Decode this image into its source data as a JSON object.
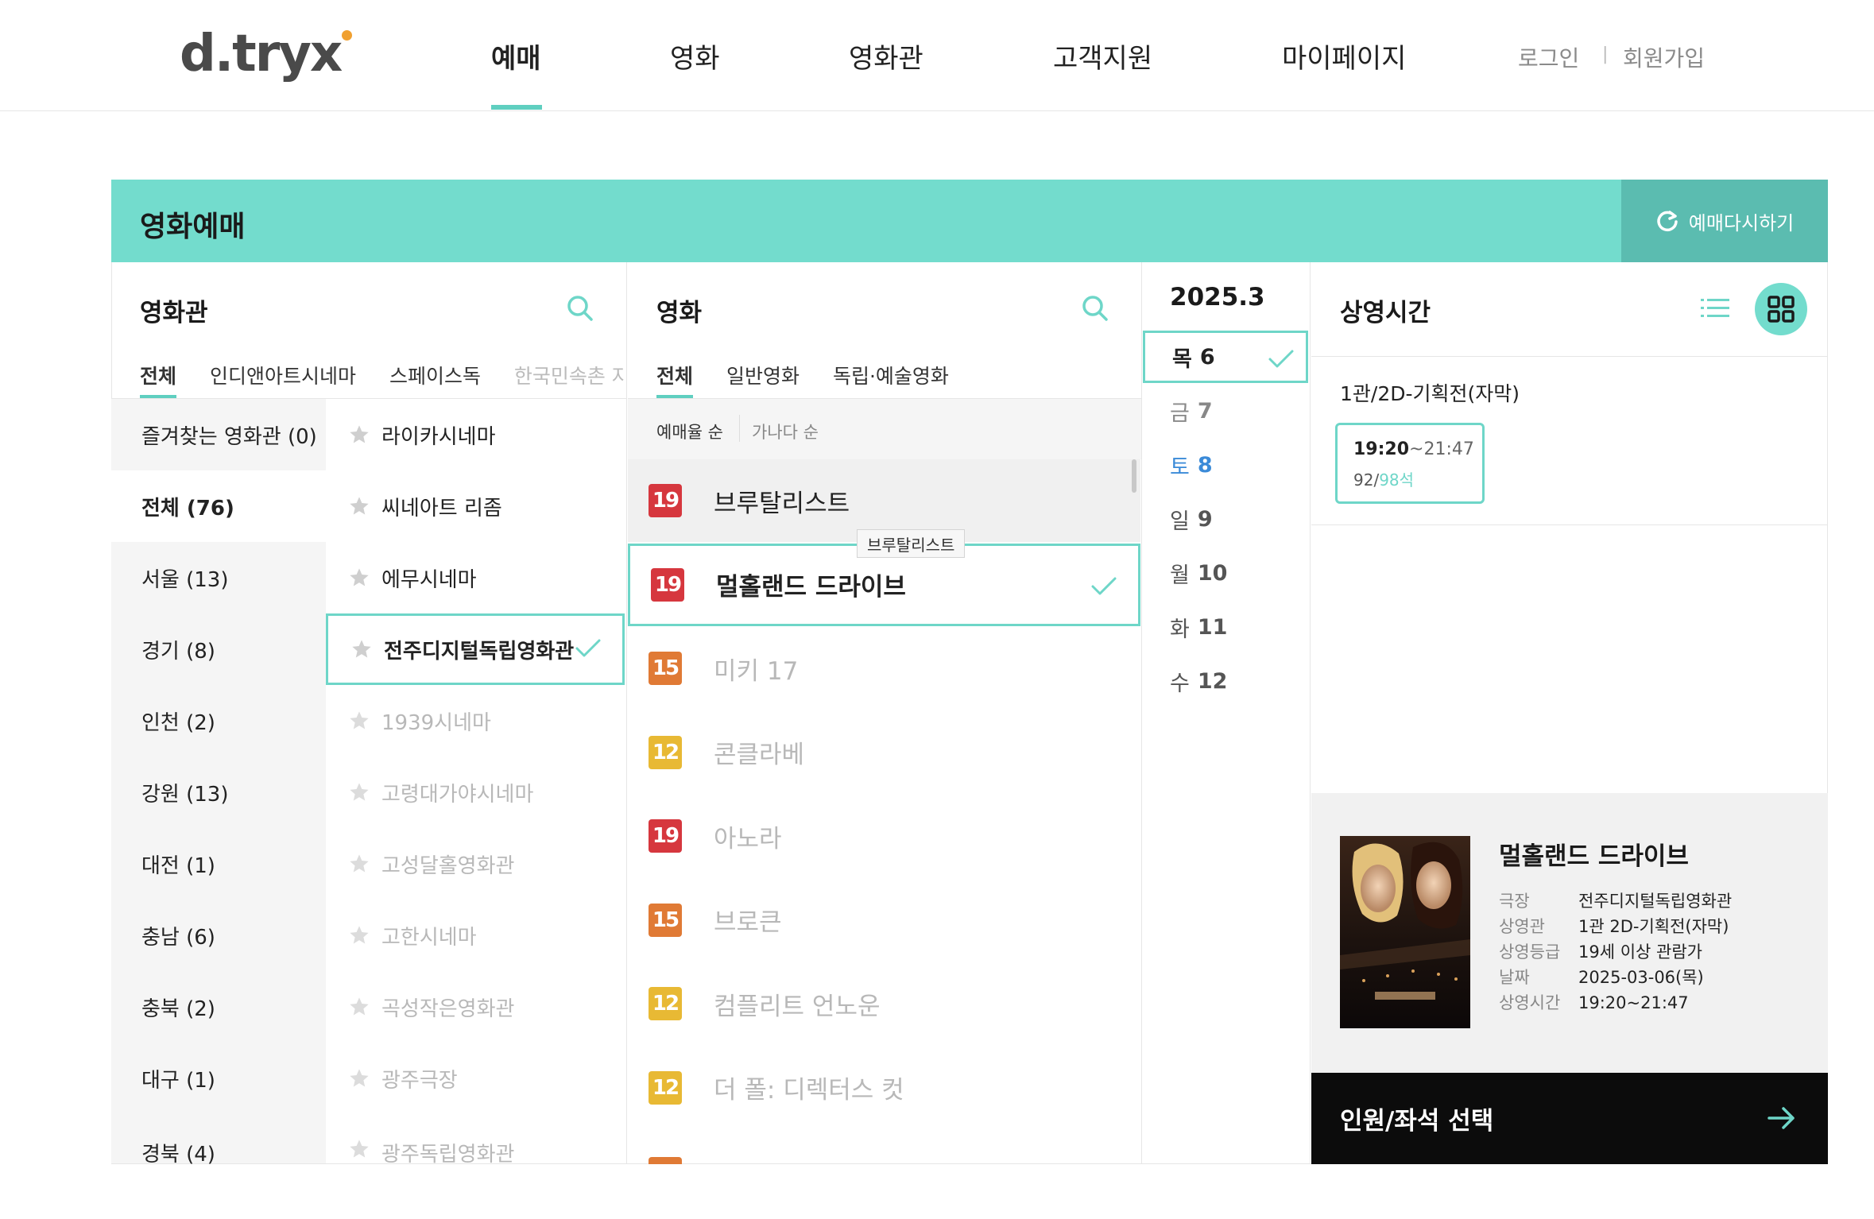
{
  "header": {
    "logo": "d.tryx",
    "nav": [
      "예매",
      "영화",
      "영화관",
      "고객지원",
      "마이페이지"
    ],
    "login": "로그인",
    "signup": "회원가입"
  },
  "banner": {
    "title": "영화예매",
    "rebook": "예매다시하기"
  },
  "cinema_panel": {
    "title": "영화관",
    "tabs": [
      "전체",
      "인디앤아트시네마",
      "스페이스독",
      "한국민속촌 자동"
    ],
    "regions": [
      "즐겨찾는 영화관 (0)",
      "전체 (76)",
      "서울 (13)",
      "경기 (8)",
      "인천 (2)",
      "강원 (13)",
      "대전 (1)",
      "충남 (6)",
      "충북 (2)",
      "대구 (1)",
      "경북 (4)"
    ],
    "cinemas": [
      "라이카시네마",
      "씨네아트 리좀",
      "에무시네마",
      "전주디지털독립영화관",
      "1939시네마",
      "고령대가야시네마",
      "고성달홀영화관",
      "고한시네마",
      "곡성작은영화관",
      "광주극장",
      "광주독립영화관"
    ]
  },
  "movie_panel": {
    "title": "영화",
    "tabs": [
      "전체",
      "일반영화",
      "독립·예술영화"
    ],
    "sort": [
      "예매율 순",
      "가나다 순"
    ],
    "movies": [
      {
        "rating": "19",
        "title": "브루탈리스트"
      },
      {
        "rating": "19",
        "title": "멀홀랜드 드라이브"
      },
      {
        "rating": "15",
        "title": "미키 17"
      },
      {
        "rating": "12",
        "title": "콘클라베"
      },
      {
        "rating": "19",
        "title": "아노라"
      },
      {
        "rating": "15",
        "title": "브로큰"
      },
      {
        "rating": "12",
        "title": "컴플리트 언노운"
      },
      {
        "rating": "12",
        "title": "더 폴: 디렉터스 컷"
      }
    ],
    "tooltip": "브루탈리스트"
  },
  "date_panel": {
    "month": "2025.3",
    "dates": [
      {
        "day": "목",
        "num": "6"
      },
      {
        "day": "금",
        "num": "7"
      },
      {
        "day": "토",
        "num": "8"
      },
      {
        "day": "일",
        "num": "9"
      },
      {
        "day": "월",
        "num": "10"
      },
      {
        "day": "화",
        "num": "11"
      },
      {
        "day": "수",
        "num": "12"
      }
    ]
  },
  "showtime_panel": {
    "title": "상영시간",
    "hall": "1관/2D-기획전(자막)",
    "slot": {
      "start": "19:20",
      "end": "~21:47",
      "remaining": "92",
      "total": "98석"
    }
  },
  "summary": {
    "movie_title": "멀홀랜드 드라이브",
    "rows": [
      {
        "label": "극장",
        "value": "전주디지털독립영화관"
      },
      {
        "label": "상영관",
        "value": "1관 2D-기획전(자막)"
      },
      {
        "label": "상영등급",
        "value": "19세 이상 관람가"
      },
      {
        "label": "날짜",
        "value": "2025-03-06(목)"
      },
      {
        "label": "상영시간",
        "value": "19:20~21:47"
      }
    ]
  },
  "cta": "인원/좌석 선택",
  "colors": {
    "accent": "#73dccd",
    "accent_dark": "#5bbcb0",
    "rating19": "#d6373e",
    "rating15": "#e07a35",
    "rating12": "#e8b934"
  }
}
